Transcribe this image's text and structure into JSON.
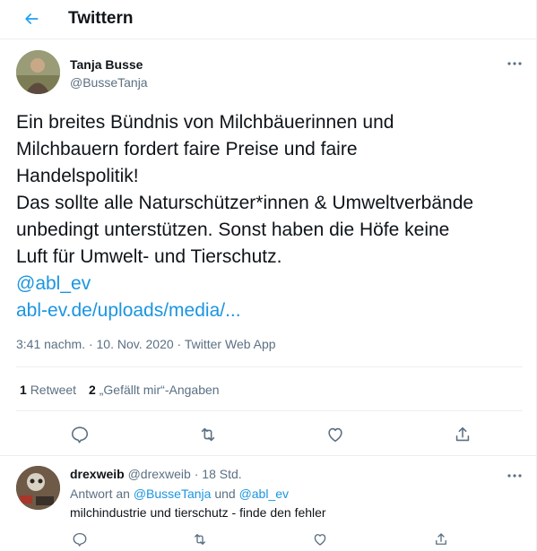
{
  "header": {
    "title": "Twittern",
    "back_icon": "back-arrow-icon",
    "accent": "#1da1f2"
  },
  "tweet": {
    "author_name": "Tanja Busse",
    "author_handle": "@BusseTanja",
    "text_lines": [
      "Ein breites Bündnis von Milchbäuerinnen und",
      "Milchbauern fordert faire Preise und faire",
      "Handelspolitik!",
      "Das sollte alle Naturschützer*innen & Umweltverbände",
      "unbedingt unterstützen. Sonst haben die Höfe keine",
      "Luft für Umwelt- und Tierschutz."
    ],
    "mention": "@abl_ev",
    "link": "abl-ev.de/uploads/media/...",
    "time": "3:41 nachm.",
    "dot": "·",
    "date": "10. Nov. 2020",
    "source": "Twitter Web App",
    "retweets_count": "1",
    "retweets_label": "Retweet",
    "likes_count": "2",
    "likes_label": "„Gefällt mir“-Angaben",
    "actions": [
      "reply-icon",
      "retweet-icon",
      "like-icon",
      "share-icon"
    ]
  },
  "reply": {
    "author_name": "drexweib",
    "author_handle": "@drexweib",
    "dot": "·",
    "time": "18 Std.",
    "reply_to_prefix": "Antwort an",
    "reply_to_user1": "@BusseTanja",
    "reply_to_and": "und",
    "reply_to_user2": "@abl_ev",
    "text": "milchindustrie und tierschutz - finde den fehler"
  },
  "colors": {
    "link": "#1b95e0",
    "secondary": "#5b7083",
    "text": "#0f1419",
    "border": "#ebeef0"
  }
}
